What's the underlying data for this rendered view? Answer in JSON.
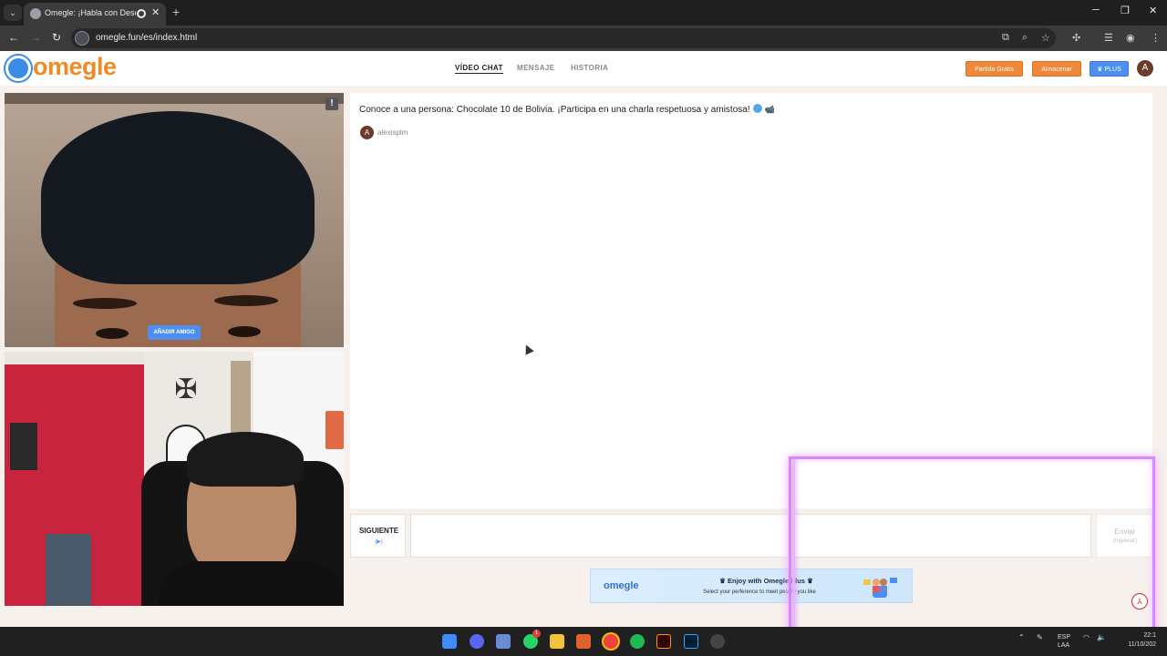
{
  "browser": {
    "tab_title": "Omegle: ¡Habla con Descon",
    "tab_close": "✕",
    "new_tab": "+",
    "url": "omegle.fun/es/index.html",
    "window_min": "─",
    "window_restore": "❐",
    "window_close": "✕"
  },
  "site": {
    "logo": "omegle",
    "nav": [
      "VÍDEO CHAT",
      "MENSAJE",
      "HISTORIA"
    ],
    "active_nav": "VÍDEO CHAT",
    "buttons": {
      "free_game": "Partida Gratis",
      "store": "Almacenar",
      "plus": "♛ PLUS"
    },
    "avatar_letter": "A"
  },
  "video": {
    "report_label": "!",
    "add_friend": "AÑADIR AMIGO"
  },
  "chat": {
    "message": "Conoce a una persona: Chocolate 10 de Bolivia. ¡Participa en una charla respetuosa y amistosa!",
    "user_avatar": "A",
    "user_name": "alexisplm",
    "next_label": "SIGUIENTE",
    "next_hint": "(▶)",
    "send_label": "Enviar",
    "send_hint": "(Ingresar)",
    "input_placeholder": ""
  },
  "banner": {
    "logo": "omegle",
    "title": "♛ Enjoy with Omegle Plus ♛",
    "subtitle": "Select your perference to meet people you like"
  },
  "taskbar": {
    "lang_top": "ESP",
    "lang_bottom": "LAA",
    "time": "22:1",
    "date": "11/10/202",
    "notification_badge": "1"
  },
  "colors": {
    "brand_orange": "#f08a24",
    "brand_blue": "#4d8ff0",
    "glow": "#d787ff"
  }
}
